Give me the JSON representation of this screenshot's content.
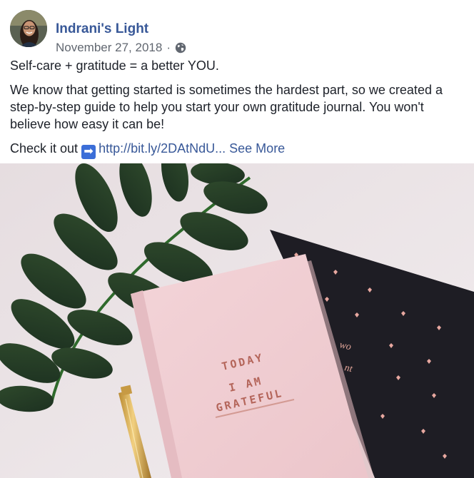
{
  "post": {
    "author": "Indrani's Light",
    "date": "November 27, 2018",
    "separator": "·",
    "privacy_icon": "globe-icon",
    "paragraph1": "Self-care + gratitude = a better YOU.",
    "paragraph2": "We know that getting started is sometimes the hardest part, so we created a step-by-step guide to help you start your own gratitude journal. You won't believe how easy it can be!",
    "check_prefix": "Check it out",
    "arrow_icon": "right-arrow-icon",
    "link_text": "http://bit.ly/2DAtNdU...",
    "see_more": "See More"
  },
  "photo": {
    "notebook_line1": "TODAY",
    "notebook_line2": "I AM",
    "notebook_line3": "GRATEFUL",
    "card_text1": "wo",
    "card_text2": "nt"
  },
  "colors": {
    "link": "#385898",
    "meta": "#616770",
    "text": "#1d2129"
  }
}
